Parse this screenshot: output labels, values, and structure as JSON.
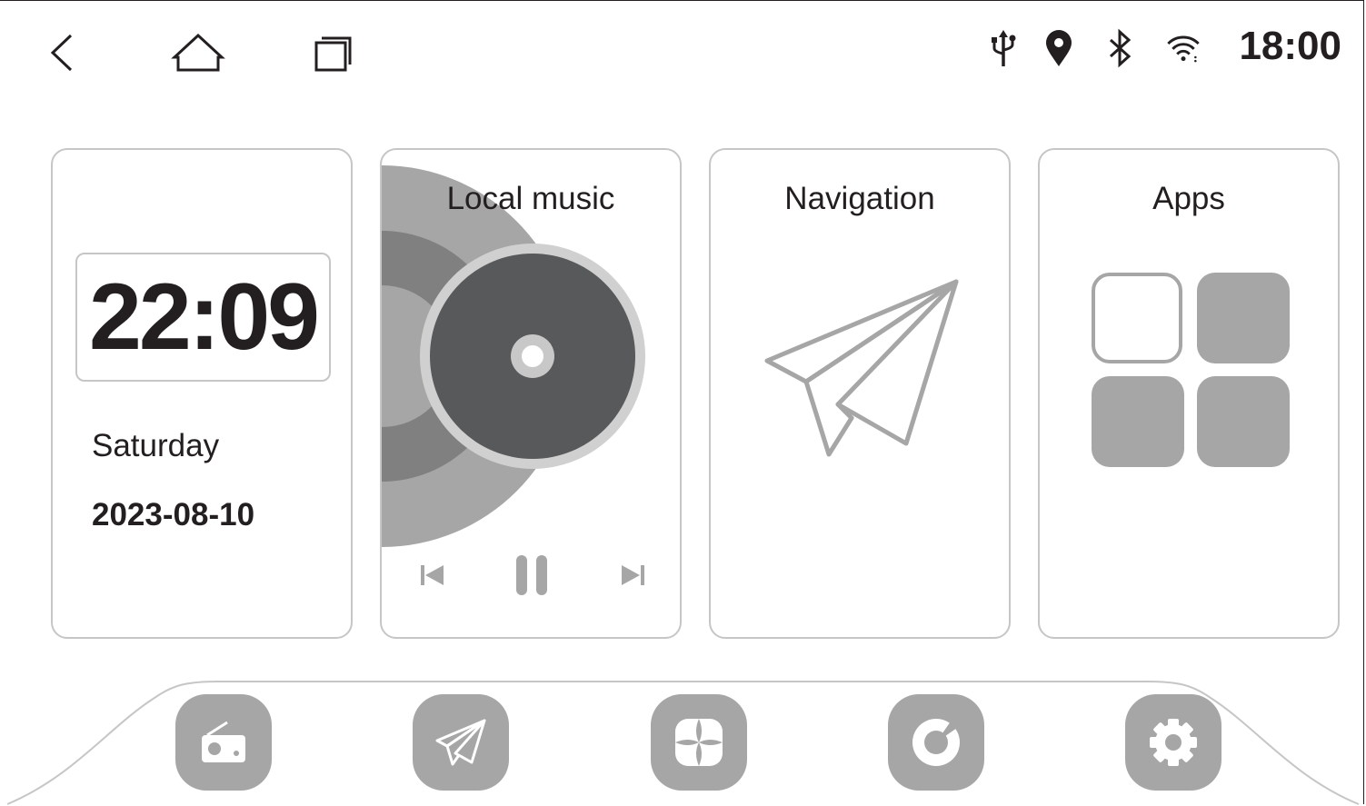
{
  "status_bar": {
    "time": "18:00",
    "icons": [
      "usb-icon",
      "location-icon",
      "bluetooth-icon",
      "wifi-icon"
    ]
  },
  "nav_bar": {
    "icons": [
      "back-icon",
      "home-icon",
      "recent-apps-icon"
    ]
  },
  "clock_card": {
    "time": "22:09",
    "day": "Saturday",
    "date": "2023-08-10"
  },
  "music_card": {
    "title": "Local music",
    "controls": [
      "previous-icon",
      "pause-icon",
      "next-icon"
    ]
  },
  "navigation_card": {
    "title": "Navigation",
    "icon": "paper-plane-icon"
  },
  "apps_card": {
    "title": "Apps",
    "icon": "app-grid-icon"
  },
  "dock": {
    "items": [
      "radio-icon",
      "navigation-icon",
      "apps-icon",
      "music-icon",
      "settings-icon"
    ]
  },
  "colors": {
    "text": "#231f20",
    "border": "#c6c6c6",
    "icon_gray": "#a6a6a6",
    "disc_dark": "#58595b"
  }
}
